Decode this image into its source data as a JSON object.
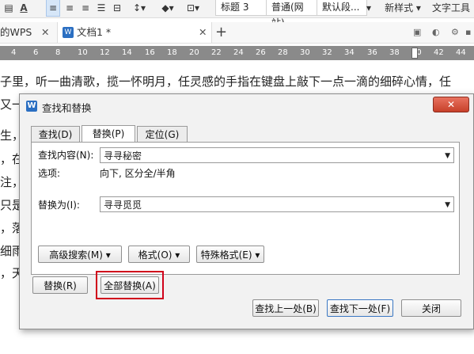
{
  "ribbon": {
    "font_color_icon": "A",
    "style_heading3": "标题 3",
    "style_normal": "普通(网站)",
    "style_default": "默认段...",
    "new_style": "新样式",
    "text_tools": "文字工具"
  },
  "tabs": [
    {
      "label": "的WPS"
    },
    {
      "label": "文档1 *"
    }
  ],
  "ruler": {
    "ticks": [
      "4",
      "6",
      "8",
      "10",
      "12",
      "14",
      "16",
      "18",
      "20",
      "22",
      "24",
      "26",
      "28",
      "30",
      "32",
      "34",
      "36",
      "38",
      "40",
      "42",
      "44"
    ]
  },
  "document": {
    "lines": [
      "子里，听一曲清歌，揽一怀明月，任灵感的手指在键盘上敲下一点一滴的细碎心情，任",
      "又一",
      "生，",
      "，在",
      "注，",
      "只是",
      "，落",
      "细雨",
      "，天"
    ]
  },
  "dialog": {
    "title": "查找和替换",
    "tabs": [
      {
        "label": "查找(D)"
      },
      {
        "label": "替换(P)"
      },
      {
        "label": "定位(G)"
      }
    ],
    "find_label": "查找内容(N):",
    "find_value": "寻寻秘密",
    "options_label": "选项:",
    "options_value": "向下, 区分全/半角",
    "replace_label": "替换为(I):",
    "replace_value": "寻寻觅觅",
    "advanced_search": "高级搜索(M)",
    "format": "格式(O)",
    "special_format": "特殊格式(E)",
    "replace_btn": "替换(R)",
    "replace_all_btn": "全部替换(A)",
    "find_prev_btn": "查找上一处(B)",
    "find_next_btn": "查找下一处(F)",
    "close_btn": "关闭"
  },
  "colors": {
    "highlight_red": "#d0021b",
    "wps_blue": "#2b6fc2",
    "ruler_gray": "#8a8a8a"
  }
}
